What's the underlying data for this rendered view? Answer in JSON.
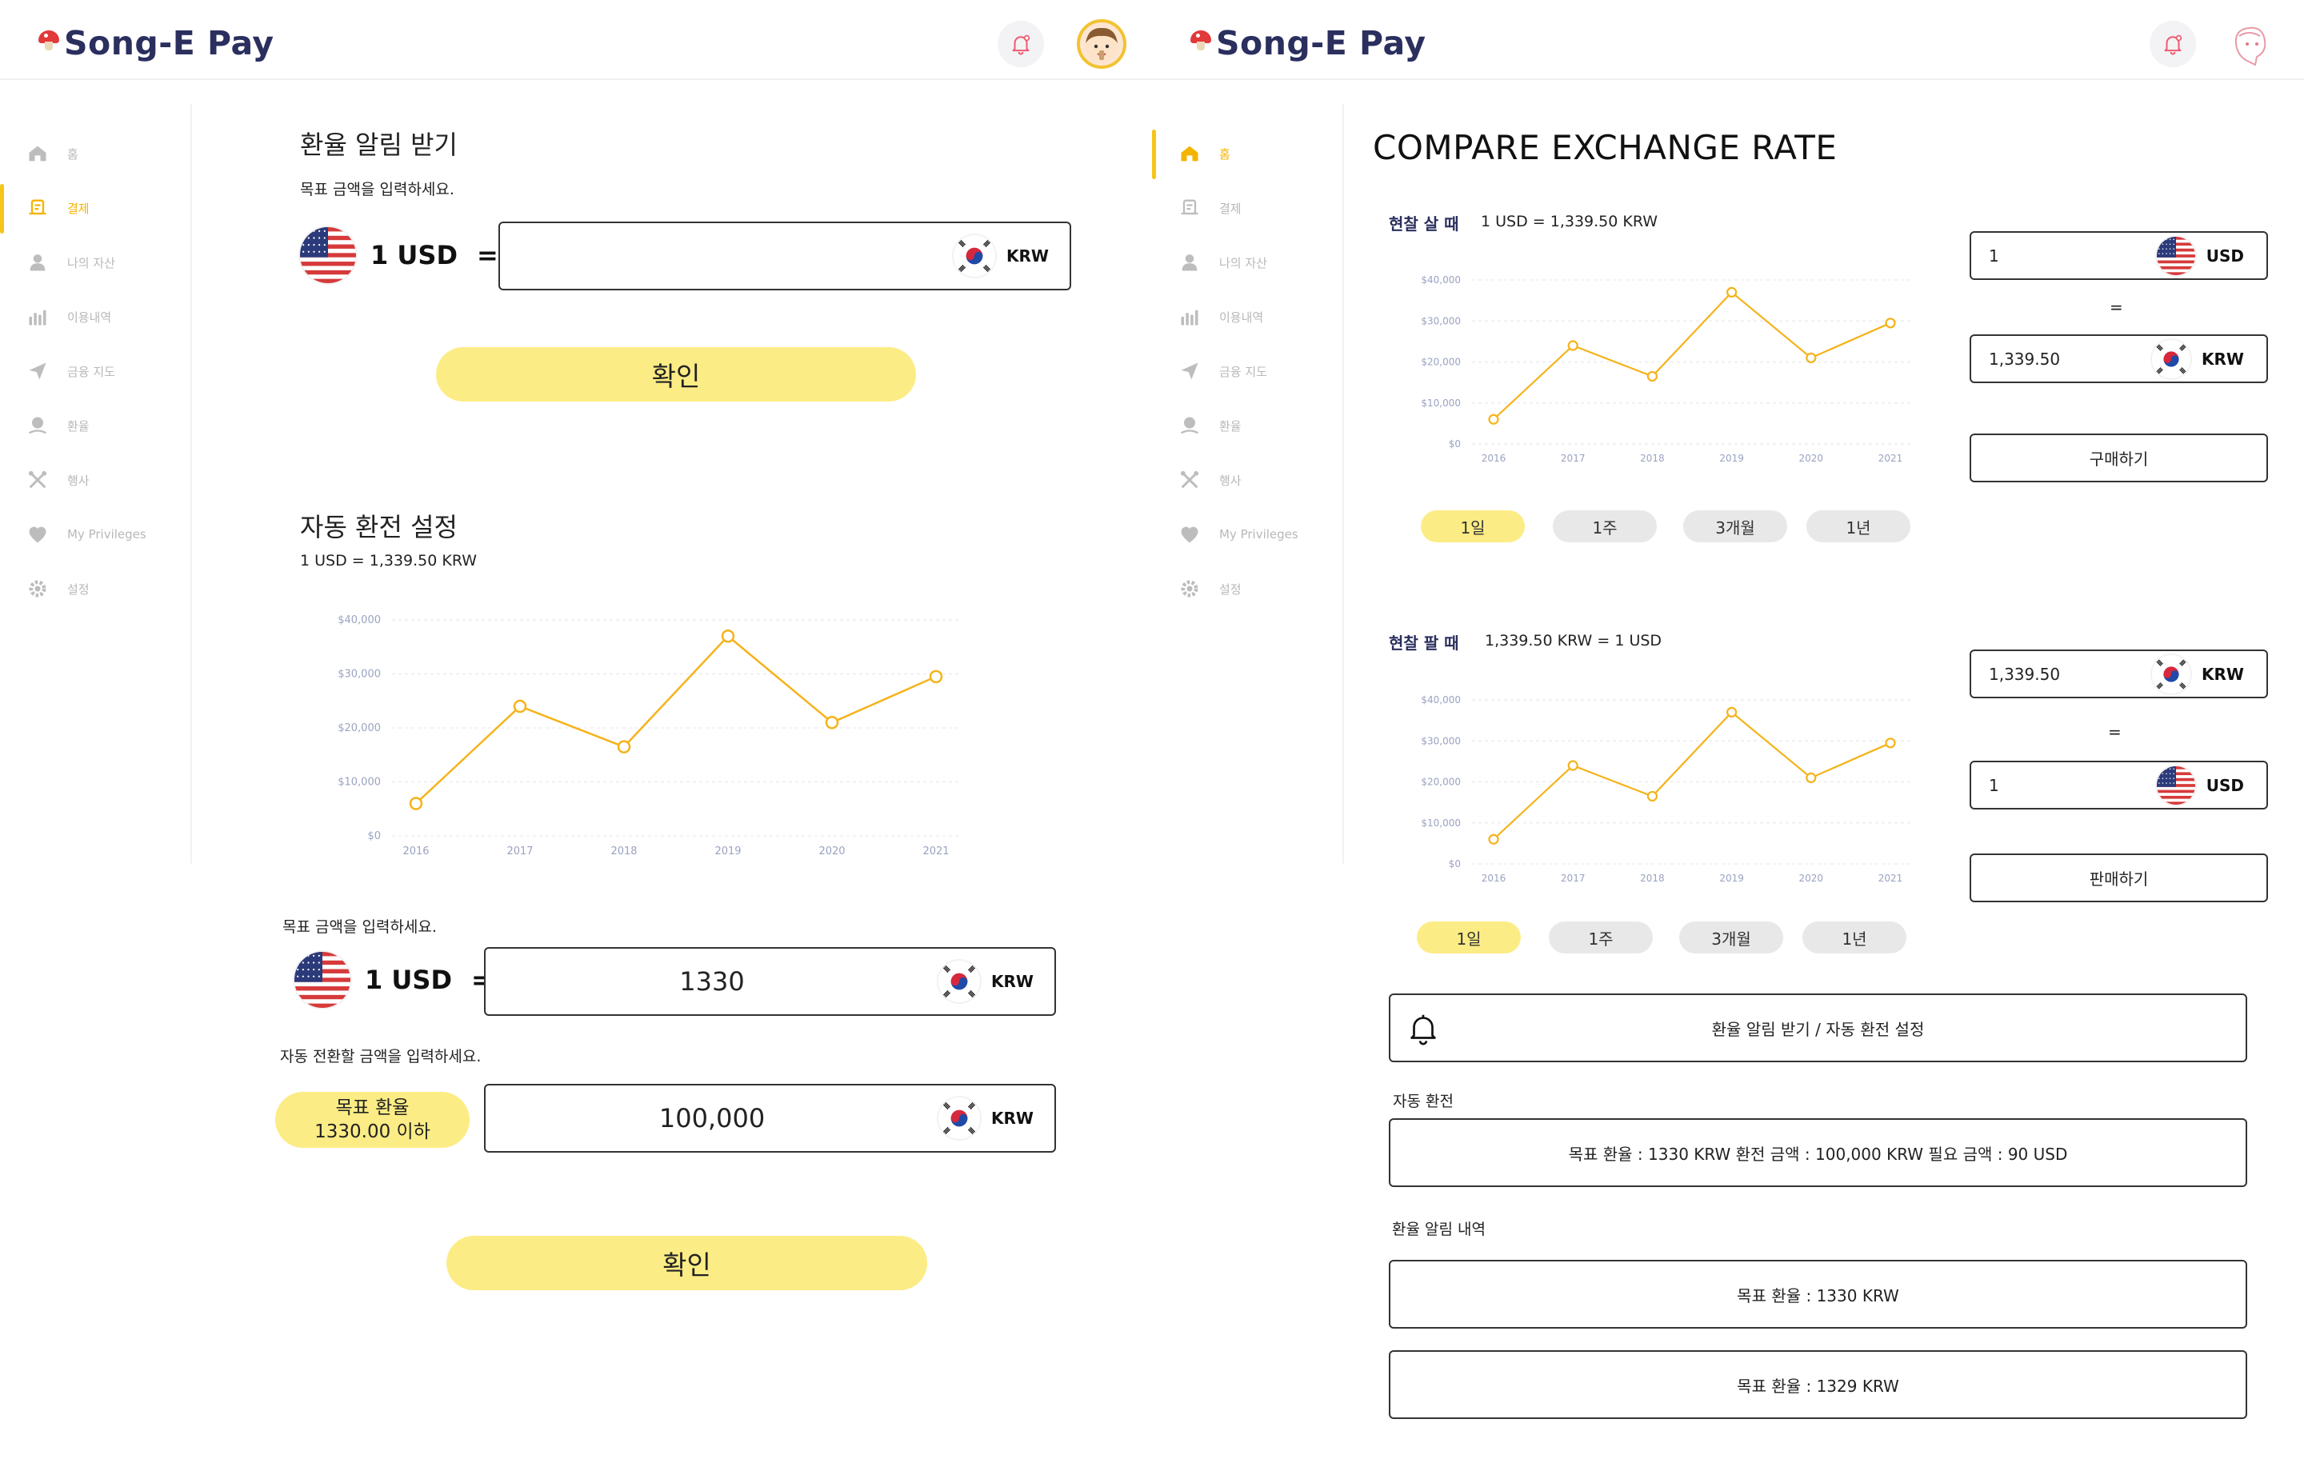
{
  "app": {
    "name": "Song-E Pay"
  },
  "sidebar": {
    "items": [
      {
        "label": "홈",
        "icon": "home-icon"
      },
      {
        "label": "결제",
        "icon": "payment-icon"
      },
      {
        "label": "나의 자산",
        "icon": "user-icon"
      },
      {
        "label": "이용내역",
        "icon": "history-icon"
      },
      {
        "label": "금융 지도",
        "icon": "map-send-icon"
      },
      {
        "label": "환율",
        "icon": "exchange-icon"
      },
      {
        "label": "행사",
        "icon": "event-icon"
      },
      {
        "label": "My Privileges",
        "icon": "privileges-icon"
      },
      {
        "label": "설정",
        "icon": "settings-icon"
      }
    ],
    "left_active_index": 1,
    "right_active_index": 0
  },
  "left": {
    "alert": {
      "title": "환율 알림 받기",
      "instruction": "목표 금액을 입력하세요.",
      "base_label": "1 USD",
      "equals": "=",
      "target_value": "",
      "target_currency": "KRW",
      "confirm_label": "확인"
    },
    "auto": {
      "title": "자동 환전 설정",
      "rate_text": "1 USD = 1,339.50 KRW",
      "instruction": "목표 금액을 입력하세요.",
      "base_label": "1 USD",
      "equals": "=",
      "target_value": "1330",
      "target_currency": "KRW",
      "amount_instruction": "자동 전환할 금액을 입력하세요.",
      "pill_line1": "목표 환율",
      "pill_line2": "1330.00 이하",
      "amount_value": "100,000",
      "amount_currency": "KRW",
      "confirm_label": "확인"
    }
  },
  "right": {
    "title": "COMPARE EXCHANGE RATE",
    "buy": {
      "label": "현찰 살 때",
      "rate_text": "1 USD = 1,339.50 KRW",
      "from_value": "1",
      "from_currency": "USD",
      "equals": "=",
      "to_value": "1,339.50",
      "to_currency": "KRW",
      "action_label": "구매하기",
      "periods": [
        "1일",
        "1주",
        "3개월",
        "1년"
      ],
      "active_period": 0
    },
    "sell": {
      "label": "현찰 팔 때",
      "rate_text": "1,339.50 KRW  = 1 USD",
      "from_value": "1,339.50",
      "from_currency": "KRW",
      "equals": "=",
      "to_value": "1",
      "to_currency": "USD",
      "action_label": "판매하기",
      "periods": [
        "1일",
        "1주",
        "3개월",
        "1년"
      ],
      "active_period": 0
    },
    "alert_button_label": "환율 알림 받기 / 자동 환전 설정",
    "auto_section_label": "자동 환전",
    "auto_summary": "목표 환율 : 1330 KRW  환전 금액 : 100,000  KRW 필요 금액 : 90 USD",
    "history_label": "환율 알림 내역",
    "history": [
      "목표 환율 : 1330 KRW",
      "목표 환율 : 1329 KRW"
    ]
  },
  "chart_data": [
    {
      "type": "line",
      "categories": [
        "2016",
        "2017",
        "2018",
        "2019",
        "2020",
        "2021"
      ],
      "values": [
        6000,
        24000,
        16500,
        37000,
        21000,
        29500
      ],
      "yticks": [
        "$0",
        "$10,000",
        "$20,000",
        "$30,000",
        "$40,000"
      ],
      "ylim": [
        0,
        40000
      ],
      "color": "#f5b31a"
    },
    {
      "type": "line",
      "categories": [
        "2016",
        "2017",
        "2018",
        "2019",
        "2020",
        "2021"
      ],
      "values": [
        6000,
        24000,
        16500,
        37000,
        21000,
        29500
      ],
      "yticks": [
        "$0",
        "$10,000",
        "$20,000",
        "$30,000",
        "$40,000"
      ],
      "ylim": [
        0,
        40000
      ],
      "color": "#f5b31a"
    },
    {
      "type": "line",
      "categories": [
        "2016",
        "2017",
        "2018",
        "2019",
        "2020",
        "2021"
      ],
      "values": [
        6000,
        24000,
        16500,
        37000,
        21000,
        29500
      ],
      "yticks": [
        "$0",
        "$10,000",
        "$20,000",
        "$30,000",
        "$40,000"
      ],
      "ylim": [
        0,
        40000
      ],
      "color": "#f5b31a"
    }
  ]
}
